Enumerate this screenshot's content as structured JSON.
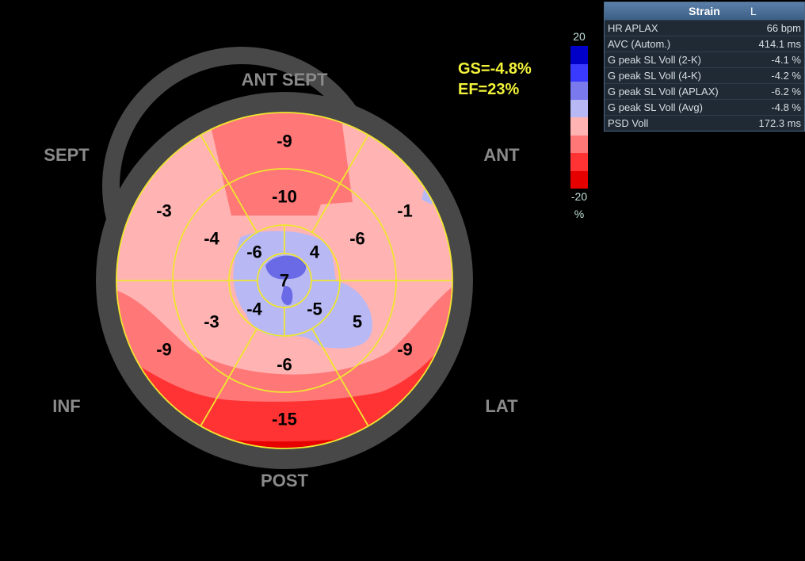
{
  "wall_labels": {
    "ant_sept": "ANT  SEPT",
    "ant": "ANT",
    "sept": "SEPT",
    "inf": "INF",
    "lat": "LAT",
    "post": "POST"
  },
  "segment_values": {
    "outer": {
      "ant_sept": "-9",
      "ant": "-1",
      "lat": "-9",
      "post": "-15",
      "inf": "-9",
      "sept": "-3"
    },
    "middle": {
      "ant_sept": "-10",
      "ant": "-6",
      "lat": "5",
      "post": "-6",
      "inf": "-3",
      "sept": "-4"
    },
    "apical": {
      "ant": "4",
      "lat": "-5",
      "inf": "-4",
      "sept": "-6"
    },
    "apex": "7"
  },
  "global": {
    "gs": "GS=-4.8%",
    "ef": "EF=23%"
  },
  "color_scale": {
    "max": "20",
    "min": "-20",
    "unit": "%",
    "colors": [
      "#0000c8",
      "#3a3aff",
      "#7a7aee",
      "#b8b8f5",
      "#ffb3b3",
      "#ff7777",
      "#ff3333",
      "#e60000"
    ]
  },
  "strain_panel": {
    "title": "Strain",
    "title_mark": "L",
    "rows": [
      {
        "label": "HR APLAX",
        "value": "66 bpm"
      },
      {
        "label": "AVC (Autom.)",
        "value": "414.1 ms"
      },
      {
        "label": "G peak SL Voll (2-K)",
        "value": "-4.1 %"
      },
      {
        "label": "G peak SL Voll (4-K)",
        "value": "-4.2 %"
      },
      {
        "label": "G peak SL Voll (APLAX)",
        "value": "-6.2 %"
      },
      {
        "label": "G peak SL Voll (Avg)",
        "value": "-4.8 %"
      },
      {
        "label": "PSD Voll",
        "value": "172.3 ms"
      }
    ]
  },
  "colors": {
    "outline": "#f0e630",
    "ring": "#484848"
  }
}
